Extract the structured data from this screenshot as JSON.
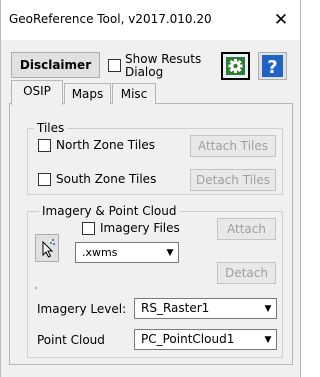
{
  "window": {
    "title": "GeoReference Tool, v2017.010.20",
    "close_glyph": "✕"
  },
  "toolbar": {
    "disclaimer_label": "Disclaimer",
    "show_results_label": "Show Resuts Dialog",
    "show_results_checked": false,
    "gear_icon": "gear-icon",
    "help_icon": "question-icon",
    "help_glyph": "?",
    "colors": {
      "gear_green": "#2e7d32",
      "help_blue": "#1e63c6"
    }
  },
  "tabs": [
    {
      "label": "OSIP",
      "active": true
    },
    {
      "label": "Maps",
      "active": false
    },
    {
      "label": "Misc",
      "active": false
    }
  ],
  "tiles": {
    "legend": "Tiles",
    "north_label": "North Zone Tiles",
    "north_checked": false,
    "south_label": "South Zone Tiles",
    "south_checked": false,
    "attach_label": "Attach Tiles",
    "detach_label": "Detach Tiles"
  },
  "imagery": {
    "legend": "Imagery & Point Cloud",
    "imagery_files_label": "Imagery Files",
    "imagery_files_checked": false,
    "file_type": ".xwms",
    "attach_label": "Attach",
    "detach_label": "Detach",
    "cursor_icon": "cursor-pick-icon",
    "imagery_level_label": "Imagery Level:",
    "imagery_level_value": "RS_Raster1",
    "point_cloud_label": "Point Cloud",
    "point_cloud_value": "PC_PointCloud1"
  }
}
